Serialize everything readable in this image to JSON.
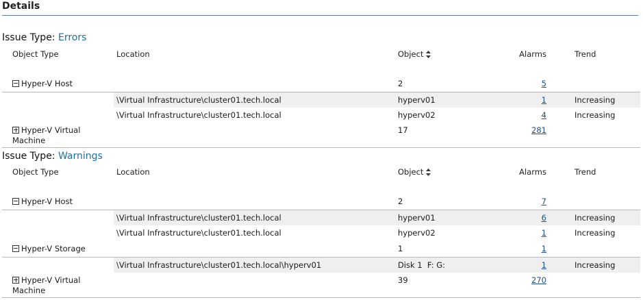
{
  "page": {
    "title": "Details"
  },
  "sections": [
    {
      "issue_label": "Issue Type:",
      "issue_value": "Errors",
      "headers": {
        "object_type": "Object Type",
        "location": "Location",
        "object": "Object",
        "alarms": "Alarms",
        "trend": "Trend"
      },
      "groups": [
        {
          "name": "Hyper-V Host",
          "count": "2",
          "alarms": "5",
          "rows": [
            {
              "location": "\\Virtual Infrastructure\\cluster01.tech.local",
              "object": "hyperv01",
              "alarms": "1",
              "trend": "Increasing"
            },
            {
              "location": "\\Virtual Infrastructure\\cluster01.tech.local",
              "object": "hyperv02",
              "alarms": "4",
              "trend": "Increasing"
            }
          ]
        },
        {
          "name": "Hyper-V Virtual Machine",
          "count": "17",
          "alarms": "281"
        }
      ]
    },
    {
      "issue_label": "Issue Type:",
      "issue_value": "Warnings",
      "headers": {
        "object_type": "Object Type",
        "location": "Location",
        "object": "Object",
        "alarms": "Alarms",
        "trend": "Trend"
      },
      "groups": [
        {
          "name": "Hyper-V Host",
          "count": "2",
          "alarms": "7",
          "rows": [
            {
              "location": "\\Virtual Infrastructure\\cluster01.tech.local",
              "object": "hyperv01",
              "alarms": "6",
              "trend": "Increasing"
            },
            {
              "location": "\\Virtual Infrastructure\\cluster01.tech.local",
              "object": "hyperv02",
              "alarms": "1",
              "trend": "Increasing"
            }
          ]
        },
        {
          "name": "Hyper-V Storage",
          "count": "1",
          "alarms": "1",
          "rows": [
            {
              "location": "\\Virtual Infrastructure\\cluster01.tech.local\\hyperv01",
              "object": "Disk 1  F: G:",
              "alarms": "1",
              "trend": "Increasing"
            }
          ]
        },
        {
          "name": "Hyper-V Virtual Machine",
          "count": "39",
          "alarms": "270"
        }
      ]
    }
  ],
  "colors": {
    "accent": "#1f6f98",
    "link": "#1f4e8c",
    "rule": "#5a7b95",
    "row_shade": "#efefef"
  },
  "icons": {
    "sort": "sort-updown-icon",
    "collapse": "collapse-minus-icon",
    "expand": "expand-plus-icon"
  }
}
